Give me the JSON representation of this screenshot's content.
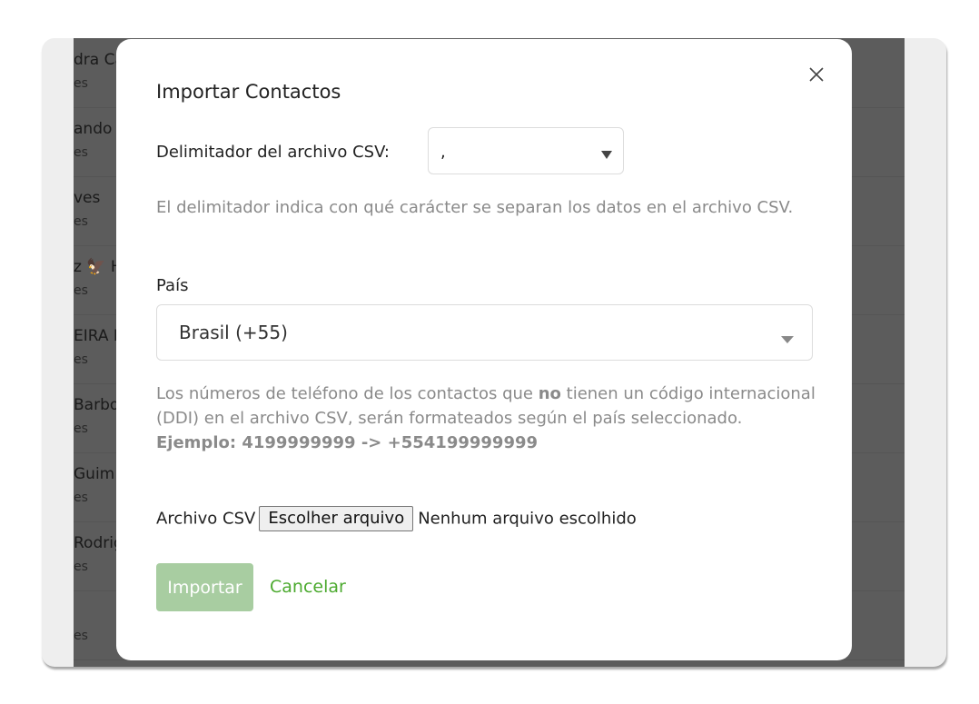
{
  "background_list": [
    {
      "name": "dra Ca",
      "sub": "es"
    },
    {
      "name": "ando",
      "sub": "es"
    },
    {
      "name": "ves",
      "sub": "es"
    },
    {
      "name": "z 🦅 H",
      "sub": "es"
    },
    {
      "name": "EIRA N",
      "sub": "es"
    },
    {
      "name": "Barbo",
      "sub": "es"
    },
    {
      "name": "Guim",
      "sub": "es"
    },
    {
      "name": "Rodrig",
      "sub": "es"
    },
    {
      "name": "",
      "sub": "es"
    }
  ],
  "modal": {
    "title": "Importar Contactos",
    "close_icon": "close-icon",
    "delimiter": {
      "label": "Delimitador del archivo CSV:",
      "value": ",",
      "help": "El delimitador indica con qué carácter se separan los datos en el archivo CSV."
    },
    "country": {
      "label": "País",
      "value": "Brasil (+55)",
      "help_part1": "Los números de teléfono de los contactos que ",
      "help_bold": "no",
      "help_part2": " tienen un código internacional (DDI) en el archivo CSV, serán formateados según el país seleccionado.",
      "example": "Ejemplo: 4199999999 -> +554199999999"
    },
    "file": {
      "label": "Archivo CSV",
      "button": "Escolher arquivo",
      "status": "Nenhum arquivo escolhido"
    },
    "import_label": "Importar",
    "cancel_label": "Cancelar"
  },
  "colors": {
    "accent_green": "#4caa2f",
    "disabled_button_green": "#a8cda1",
    "help_text": "#8a8a8a",
    "overlay": "#5c5c5c"
  }
}
